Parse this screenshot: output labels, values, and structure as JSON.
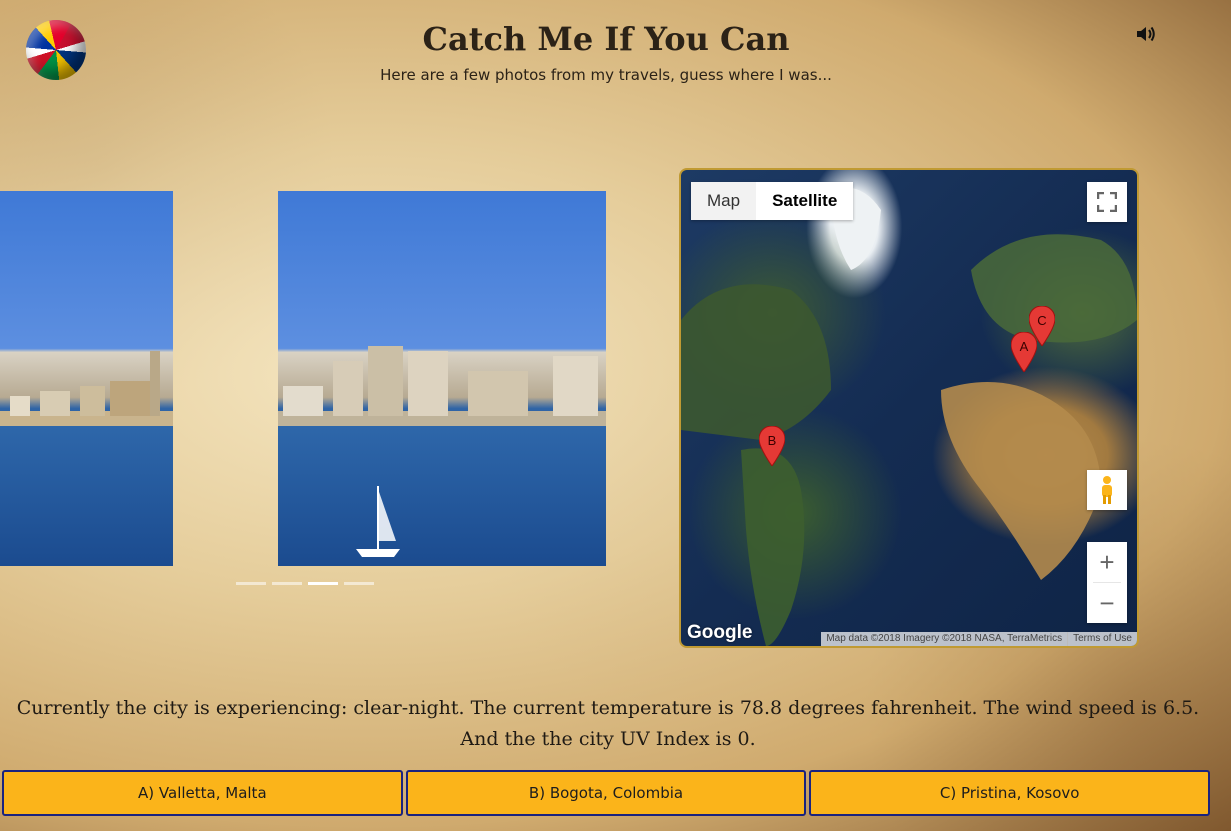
{
  "header": {
    "title": "Catch Me If You Can",
    "subtitle": "Here are a few photos from my travels, guess where I was..."
  },
  "icons": {
    "logo": "globe-flags-icon",
    "sound": "speaker-icon"
  },
  "carousel": {
    "slide_count": 4,
    "active_slide": 3
  },
  "map": {
    "type_buttons": [
      "Map",
      "Satellite"
    ],
    "active_type": "Satellite",
    "markers": [
      "A",
      "B",
      "C"
    ],
    "zoom_in_label": "+",
    "zoom_out_label": "−",
    "logo_text": "Google",
    "attribution": "Map data ©2018 Imagery ©2018 NASA, TerraMetrics",
    "terms": "Terms of Use"
  },
  "weather_text": "Currently the city is experiencing: clear-night. The current temperature is 78.8 degrees fahrenheit. The wind speed is 6.5. And the the city UV Index is 0.",
  "answers": [
    "A) Valletta, Malta",
    "B) Bogota, Colombia",
    "C) Pristina, Kosovo"
  ],
  "colors": {
    "answer_bg": "#fbb41a",
    "answer_border": "#1a237e",
    "marker": "#e53935"
  }
}
